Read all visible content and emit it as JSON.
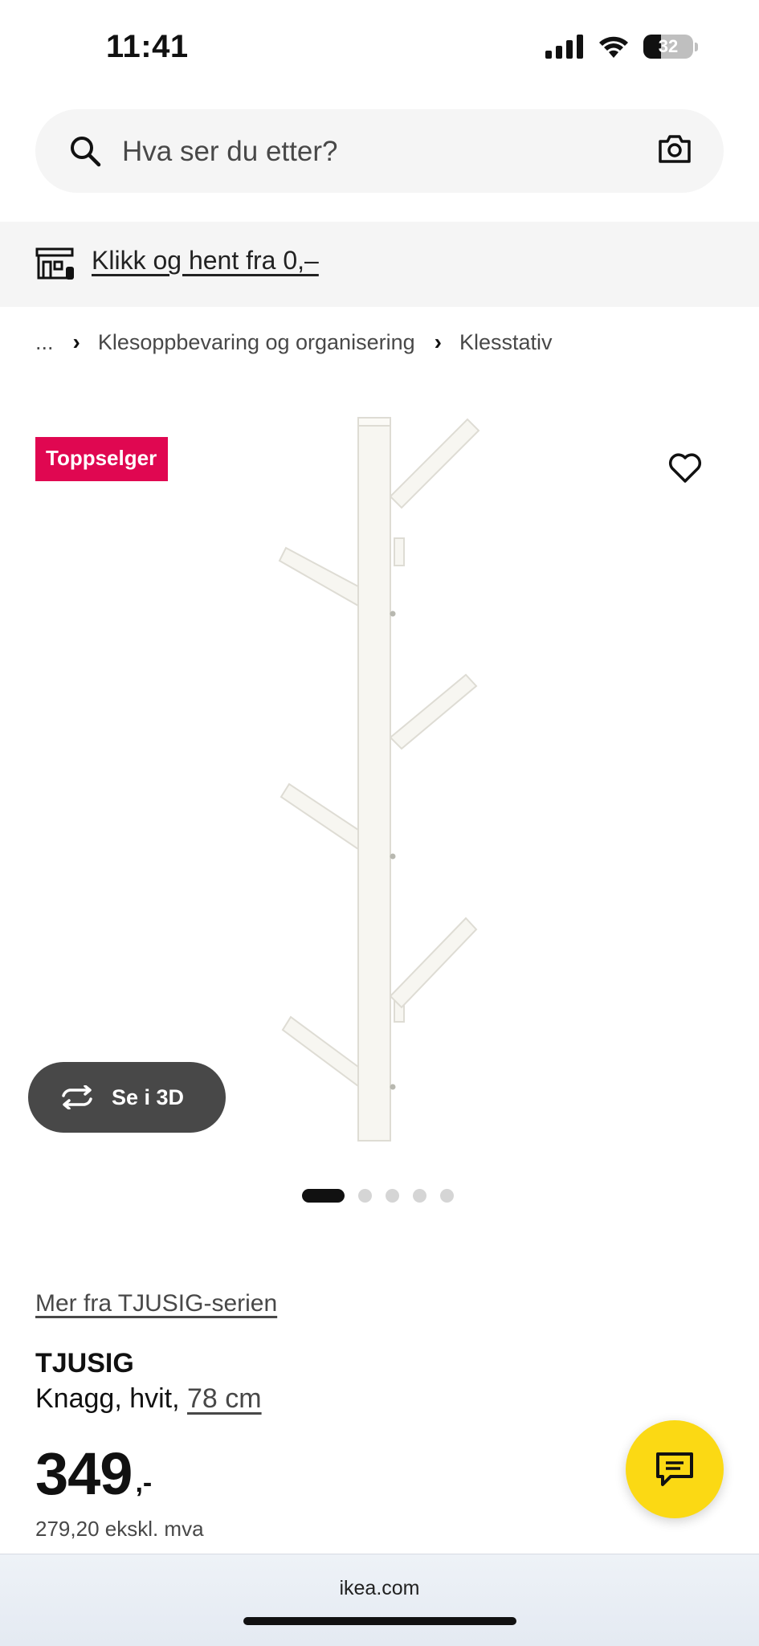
{
  "status_bar": {
    "time": "11:41",
    "battery": "32"
  },
  "search": {
    "placeholder": "Hva ser du etter?"
  },
  "click_collect": {
    "label": "Klikk og hent fra 0,–"
  },
  "breadcrumb": {
    "ellipsis": "...",
    "items": [
      "Klesoppbevaring og organisering",
      "Klesstativ"
    ]
  },
  "badge": "Toppselger",
  "view_3d": {
    "label": "Se i 3D"
  },
  "carousel": {
    "total": 5,
    "active": 1
  },
  "product": {
    "series_link": "Mer fra TJUSIG-serien",
    "name": "TJUSIG",
    "desc_prefix": "Knagg, hvit, ",
    "size": "78 cm",
    "price_main": "349",
    "price_decimal": ",-",
    "price_ex_vat": "279,20 ekskl. mva"
  },
  "browser": {
    "url": "ikea.com"
  },
  "colors": {
    "badge": "#e00751",
    "chat_fab": "#fbd914",
    "dark_button": "#484848"
  },
  "icons": [
    "search-icon",
    "camera-icon",
    "store-icon",
    "chevron-right-icon",
    "heart-icon",
    "rotate-3d-icon",
    "chat-icon",
    "signal-icon",
    "wifi-icon",
    "battery-icon"
  ]
}
